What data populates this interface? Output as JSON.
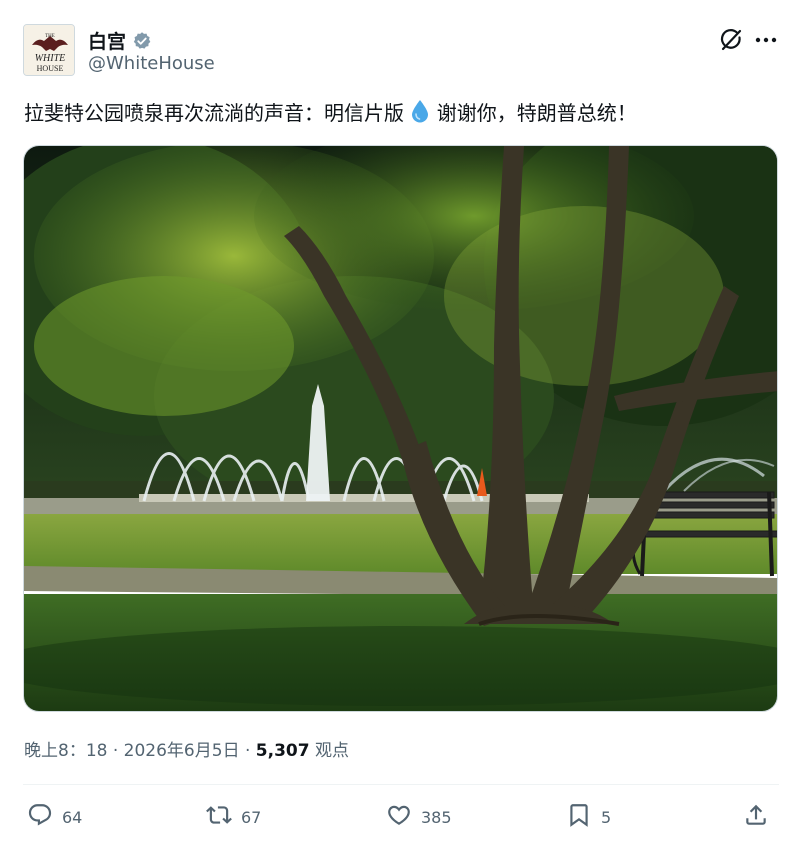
{
  "author": {
    "display_name": "白宫",
    "handle": "@WhiteHouse",
    "avatar_lines": [
      "THE",
      "WHITE",
      "HOUSE"
    ]
  },
  "post": {
    "text_before_emoji": "拉斐特公园喷泉再次流淌的声音：明信片版",
    "emoji": "droplet",
    "text_after_emoji": "谢谢你，特朗普总统！"
  },
  "meta": {
    "time": "晚上8：18",
    "sep1": " · ",
    "date": "2026年6月5日",
    "sep2": " · ",
    "views_count": "5,307",
    "views_label": "观点"
  },
  "actions": {
    "replies": "64",
    "reposts": "67",
    "likes": "385",
    "bookmarks": "5"
  },
  "colors": {
    "text": "#0f1419",
    "secondary": "#536471",
    "verified": "#829aab",
    "divider": "#eff3f4"
  }
}
